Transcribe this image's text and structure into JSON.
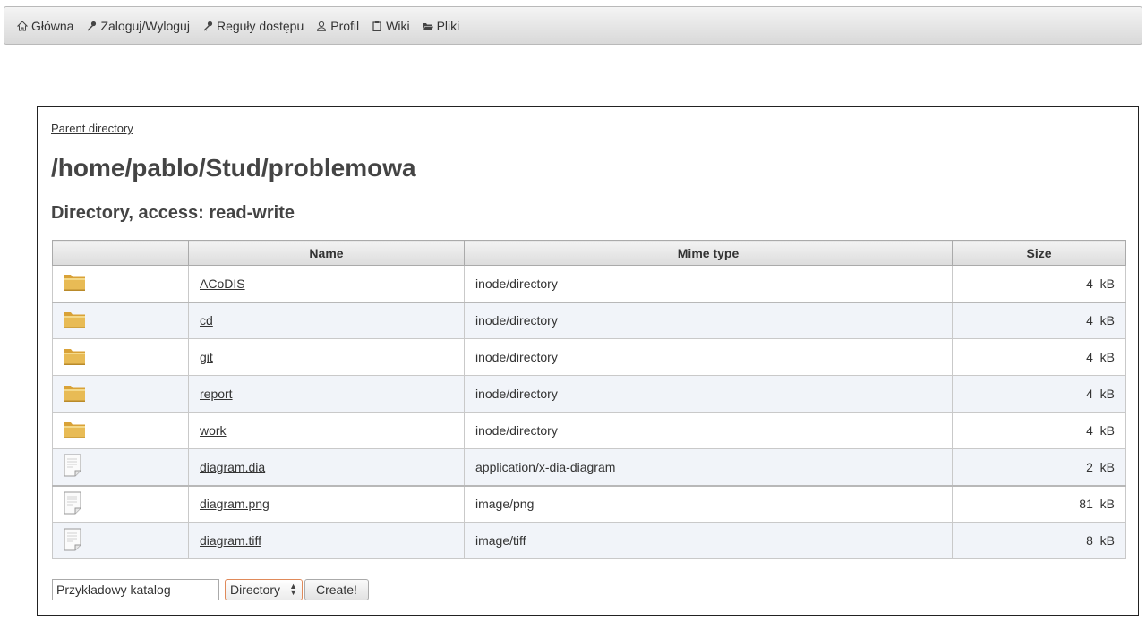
{
  "nav": {
    "items": [
      {
        "icon": "home-icon",
        "label": "Główna"
      },
      {
        "icon": "key-icon",
        "label": "Zaloguj/Wyloguj"
      },
      {
        "icon": "key-icon",
        "label": "Reguły dostępu"
      },
      {
        "icon": "user-icon",
        "label": "Profil"
      },
      {
        "icon": "clipboard-icon",
        "label": "Wiki"
      },
      {
        "icon": "folder-open-icon",
        "label": "Pliki"
      }
    ]
  },
  "main": {
    "parent_link": "Parent directory",
    "path": "/home/pablo/Stud/problemowa",
    "access": "Directory, access: read-write"
  },
  "table": {
    "columns": [
      "",
      "Name",
      "Mime type",
      "Size"
    ],
    "rows": [
      {
        "type": "folder-icon",
        "name": "ACoDIS",
        "mime": "inode/directory",
        "size": "4  kB"
      },
      {
        "type": "folder-icon",
        "name": "cd",
        "mime": "inode/directory",
        "size": "4  kB"
      },
      {
        "type": "folder-icon",
        "name": "git",
        "mime": "inode/directory",
        "size": "4  kB"
      },
      {
        "type": "folder-icon",
        "name": "report",
        "mime": "inode/directory",
        "size": "4  kB"
      },
      {
        "type": "folder-icon",
        "name": "work",
        "mime": "inode/directory",
        "size": "4  kB"
      },
      {
        "type": "file-icon",
        "name": "diagram.dia",
        "mime": "application/x-dia-diagram",
        "size": "2  kB"
      },
      {
        "type": "file-icon",
        "name": "diagram.png",
        "mime": "image/png",
        "size": "81  kB"
      },
      {
        "type": "file-icon",
        "name": "diagram.tiff",
        "mime": "image/tiff",
        "size": "8  kB"
      }
    ]
  },
  "create": {
    "input_value": "Przykładowy katalog",
    "select_value": "Directory",
    "button_label": "Create!"
  },
  "colors": {
    "folder": "#e2b24a",
    "select_border": "#e08a5a"
  }
}
